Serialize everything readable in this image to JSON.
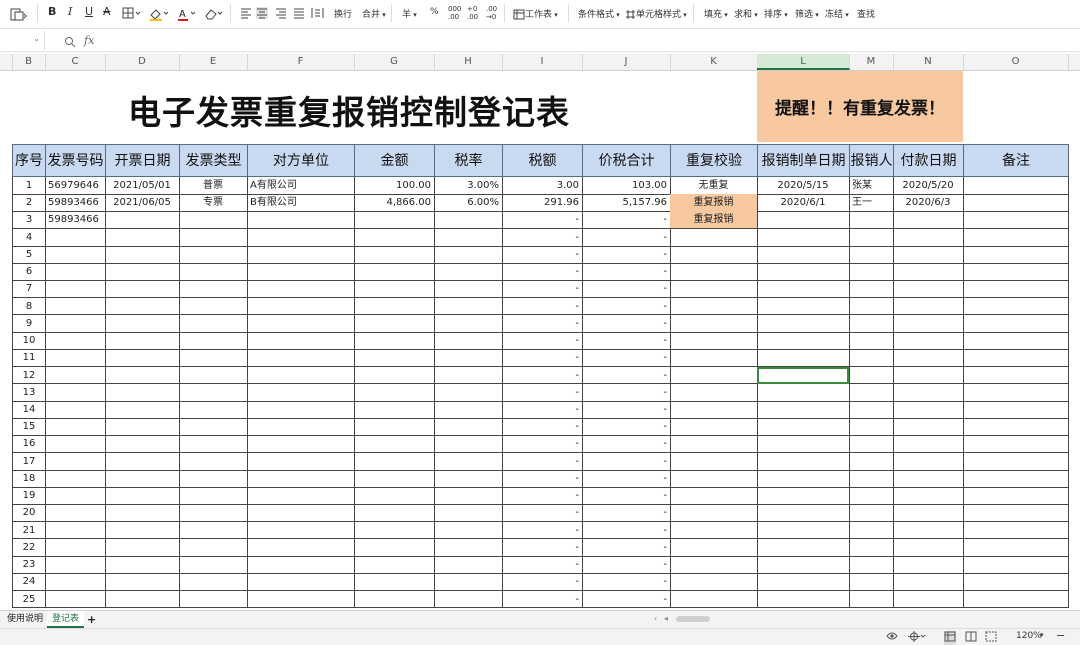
{
  "toolbar": {
    "wrap_label": "换行",
    "merge_label": "合并",
    "currency_label": "羊",
    "percent_label": "%",
    "worksheet_label": "工作表",
    "cond_format_label": "条件格式",
    "cell_style_label": "单元格样式",
    "fill_label": "填充",
    "sum_label": "求和",
    "sort_label": "排序",
    "filter_label": "筛选",
    "freeze_label": "冻结",
    "find_label": "查找"
  },
  "formula": {
    "fx": "fx",
    "value": ""
  },
  "columns": [
    "B",
    "C",
    "D",
    "E",
    "F",
    "G",
    "H",
    "I",
    "J",
    "K",
    "L",
    "M",
    "N",
    "O"
  ],
  "selected_column": "L",
  "sheet": {
    "title": "电子发票重复报销控制登记表",
    "reminder": "提醒！！有重复发票！",
    "headers": [
      "序号",
      "发票号码",
      "开票日期",
      "发票类型",
      "对方单位",
      "金额",
      "税率",
      "税额",
      "价税合计",
      "重复校验",
      "报销制单日期",
      "报销人",
      "付款日期",
      "备注"
    ],
    "rows": [
      [
        "1",
        "56979646",
        "2021/05/01",
        "普票",
        "A有限公司",
        "100.00",
        "3.00%",
        "3.00",
        "103.00",
        "无重复",
        "2020/5/15",
        "张某",
        "2020/5/20",
        ""
      ],
      [
        "2",
        "59893466",
        "2021/06/05",
        "专票",
        "B有限公司",
        "4,866.00",
        "6.00%",
        "291.96",
        "5,157.96",
        "重复报销",
        "2020/6/1",
        "王一",
        "2020/6/3",
        ""
      ],
      [
        "3",
        "59893466",
        "",
        "",
        "",
        "",
        "",
        "-",
        "-",
        "重复报销",
        "",
        "",
        "",
        ""
      ],
      [
        "4",
        "",
        "",
        "",
        "",
        "",
        "",
        "-",
        "-",
        "",
        "",
        "",
        "",
        ""
      ],
      [
        "5",
        "",
        "",
        "",
        "",
        "",
        "",
        "-",
        "-",
        "",
        "",
        "",
        "",
        ""
      ],
      [
        "6",
        "",
        "",
        "",
        "",
        "",
        "",
        "-",
        "-",
        "",
        "",
        "",
        "",
        ""
      ],
      [
        "7",
        "",
        "",
        "",
        "",
        "",
        "",
        "-",
        "-",
        "",
        "",
        "",
        "",
        ""
      ],
      [
        "8",
        "",
        "",
        "",
        "",
        "",
        "",
        "-",
        "-",
        "",
        "",
        "",
        "",
        ""
      ],
      [
        "9",
        "",
        "",
        "",
        "",
        "",
        "",
        "-",
        "-",
        "",
        "",
        "",
        "",
        ""
      ],
      [
        "10",
        "",
        "",
        "",
        "",
        "",
        "",
        "-",
        "-",
        "",
        "",
        "",
        "",
        ""
      ],
      [
        "11",
        "",
        "",
        "",
        "",
        "",
        "",
        "-",
        "-",
        "",
        "",
        "",
        "",
        ""
      ],
      [
        "12",
        "",
        "",
        "",
        "",
        "",
        "",
        "-",
        "-",
        "",
        "",
        "",
        "",
        ""
      ],
      [
        "13",
        "",
        "",
        "",
        "",
        "",
        "",
        "-",
        "-",
        "",
        "",
        "",
        "",
        ""
      ],
      [
        "14",
        "",
        "",
        "",
        "",
        "",
        "",
        "-",
        "-",
        "",
        "",
        "",
        "",
        ""
      ],
      [
        "15",
        "",
        "",
        "",
        "",
        "",
        "",
        "-",
        "-",
        "",
        "",
        "",
        "",
        ""
      ],
      [
        "16",
        "",
        "",
        "",
        "",
        "",
        "",
        "-",
        "-",
        "",
        "",
        "",
        "",
        ""
      ],
      [
        "17",
        "",
        "",
        "",
        "",
        "",
        "",
        "-",
        "-",
        "",
        "",
        "",
        "",
        ""
      ],
      [
        "18",
        "",
        "",
        "",
        "",
        "",
        "",
        "-",
        "-",
        "",
        "",
        "",
        "",
        ""
      ],
      [
        "19",
        "",
        "",
        "",
        "",
        "",
        "",
        "-",
        "-",
        "",
        "",
        "",
        "",
        ""
      ],
      [
        "20",
        "",
        "",
        "",
        "",
        "",
        "",
        "-",
        "-",
        "",
        "",
        "",
        "",
        ""
      ],
      [
        "21",
        "",
        "",
        "",
        "",
        "",
        "",
        "-",
        "-",
        "",
        "",
        "",
        "",
        ""
      ],
      [
        "22",
        "",
        "",
        "",
        "",
        "",
        "",
        "-",
        "-",
        "",
        "",
        "",
        "",
        ""
      ],
      [
        "23",
        "",
        "",
        "",
        "",
        "",
        "",
        "-",
        "-",
        "",
        "",
        "",
        "",
        ""
      ],
      [
        "24",
        "",
        "",
        "",
        "",
        "",
        "",
        "-",
        "-",
        "",
        "",
        "",
        "",
        ""
      ],
      [
        "25",
        "",
        "",
        "",
        "",
        "",
        "",
        "-",
        "-",
        "",
        "",
        "",
        "",
        ""
      ]
    ],
    "duplicate_flag": "重复报销",
    "duplicate_color": "#f8c9a0",
    "header_color": "#c9daf0"
  },
  "tabs": [
    "使用说明",
    "登记表"
  ],
  "active_tab": "登记表",
  "add_sheet": "+",
  "status": {
    "zoom": "120%"
  }
}
